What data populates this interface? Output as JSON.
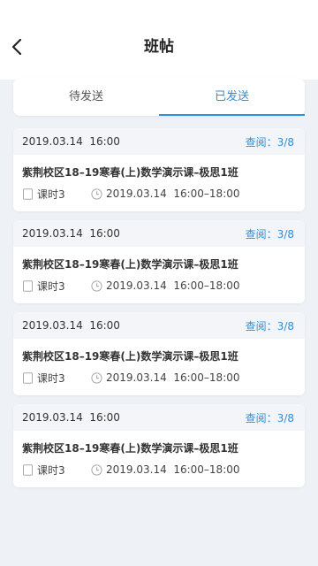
{
  "header": {
    "title": "班帖",
    "back_icon": "chevron-left-icon"
  },
  "tabs": [
    {
      "label": "待发送",
      "active": false
    },
    {
      "label": "已发送",
      "active": true
    }
  ],
  "colors": {
    "accent": "#2f8fd8",
    "background": "#eef1f6",
    "card_header": "#f4f5f8"
  },
  "posts": [
    {
      "date": "2019.03.14  16:00",
      "read_label": "查阅：",
      "read_count": "3/8",
      "class_name": "紫荆校区18–19寒春(上)数学演示课–极思1班",
      "lesson": "课时3",
      "time": "2019.03.14  16:00–18:00"
    },
    {
      "date": "2019.03.14  16:00",
      "read_label": "查阅：",
      "read_count": "3/8",
      "class_name": "紫荆校区18–19寒春(上)数学演示课–极思1班",
      "lesson": "课时3",
      "time": "2019.03.14  16:00–18:00"
    },
    {
      "date": "2019.03.14  16:00",
      "read_label": "查阅：",
      "read_count": "3/8",
      "class_name": "紫荆校区18–19寒春(上)数学演示课–极思1班",
      "lesson": "课时3",
      "time": "2019.03.14  16:00–18:00"
    },
    {
      "date": "2019.03.14  16:00",
      "read_label": "查阅：",
      "read_count": "3/8",
      "class_name": "紫荆校区18–19寒春(上)数学演示课–极思1班",
      "lesson": "课时3",
      "time": "2019.03.14  16:00–18:00"
    }
  ]
}
